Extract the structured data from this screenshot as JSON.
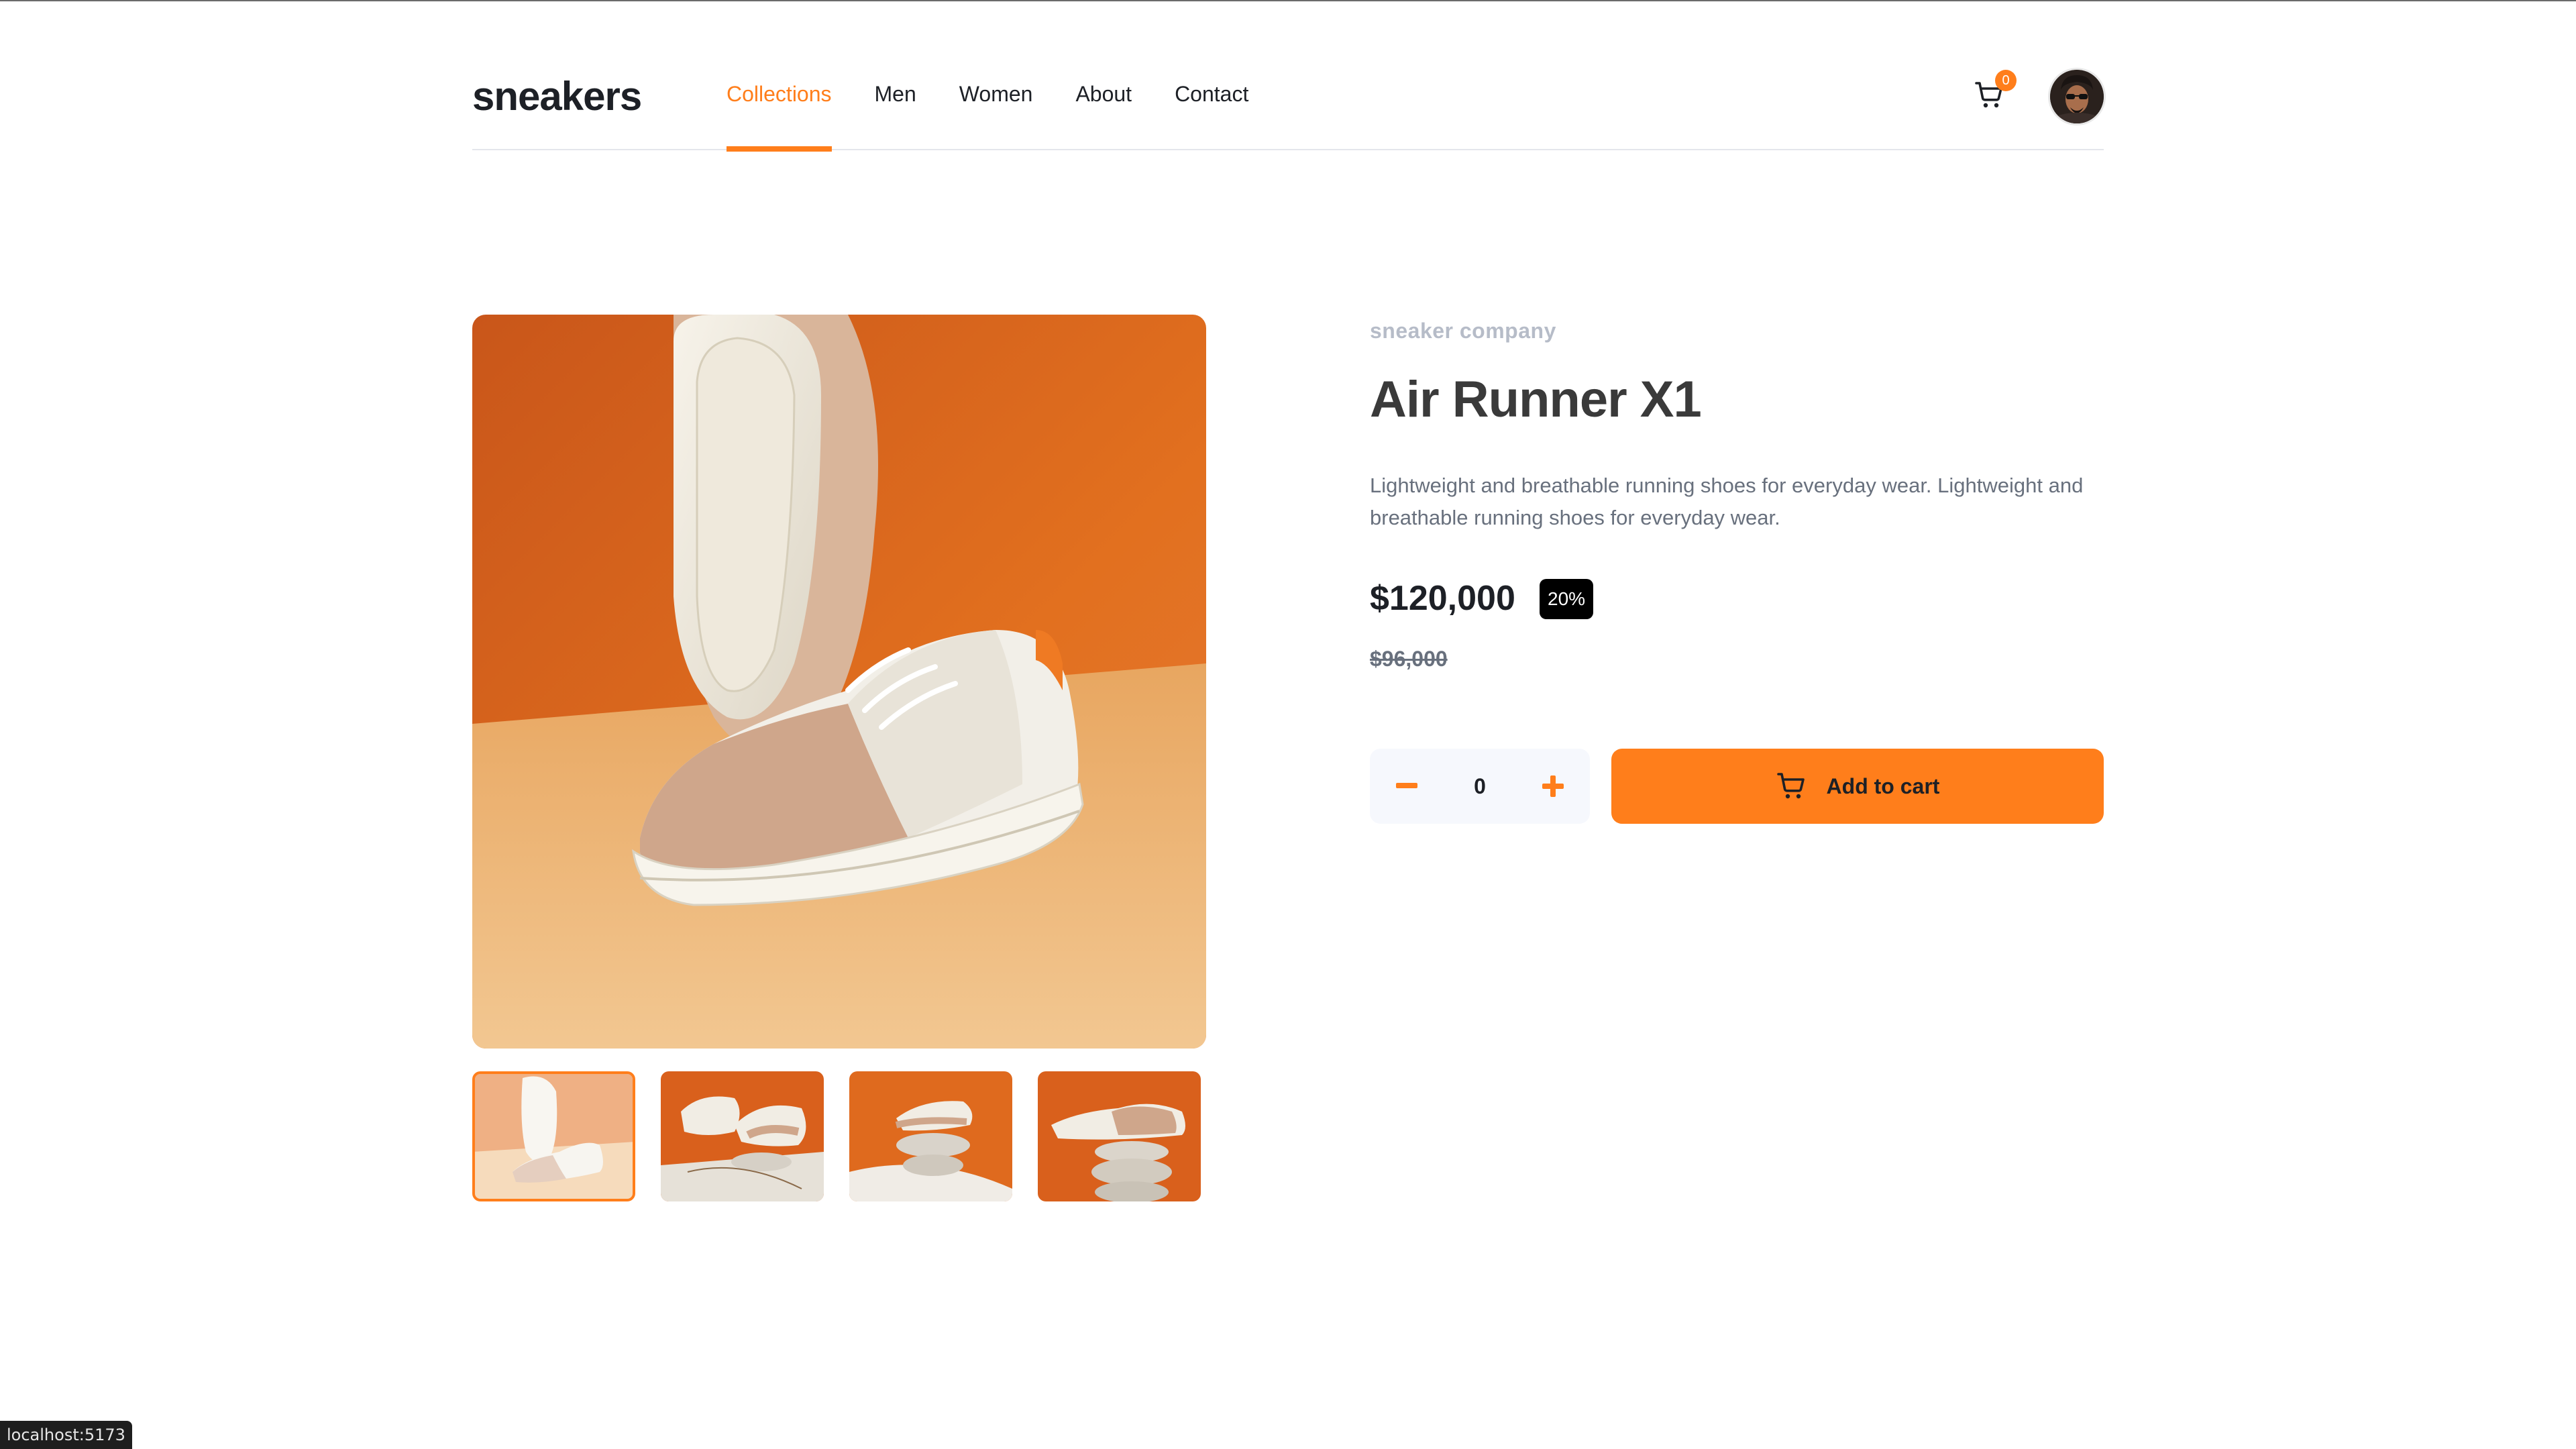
{
  "header": {
    "logo": "sneakers",
    "nav": [
      {
        "label": "Collections",
        "active": true
      },
      {
        "label": "Men",
        "active": false
      },
      {
        "label": "Women",
        "active": false
      },
      {
        "label": "About",
        "active": false
      },
      {
        "label": "Contact",
        "active": false
      }
    ],
    "cart_count": "0"
  },
  "product": {
    "company": "sneaker company",
    "title": "Air Runner X1",
    "description": "Lightweight and breathable running shoes for everyday wear. Lightweight and breathable running shoes for everyday wear.",
    "price": "$120,000",
    "discount": "20%",
    "old_price": "$96,000"
  },
  "cart_controls": {
    "minus_label": "−",
    "quantity": "0",
    "plus_label": "+",
    "add_label": "Add to cart"
  },
  "status_bar": {
    "url": "localhost:5173"
  },
  "colors": {
    "accent": "#ff7e1b",
    "text_dark": "#1d2026",
    "text_muted": "#68707d",
    "company": "#b6bcc8"
  }
}
